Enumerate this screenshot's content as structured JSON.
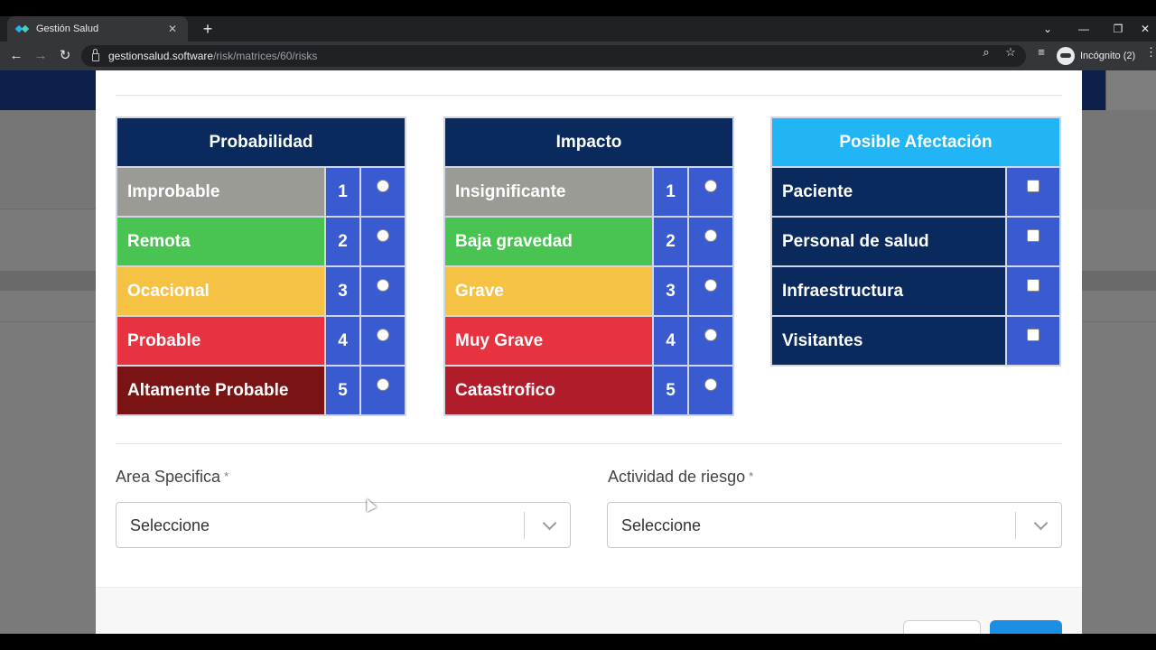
{
  "browser": {
    "tab_title": "Gestión Salud",
    "tab_close": "✕",
    "new_tab": "+",
    "url_host": "gestionsalud.software",
    "url_path": "/risk/matrices/60/risks",
    "profile_label": "Incógnito (2)",
    "icons": {
      "back": "←",
      "forward": "→",
      "reload": "↻",
      "zoom": "⌕",
      "star": "☆",
      "media": "≡",
      "menu": "⋮",
      "chevron": "⌄",
      "minimize": "—",
      "restore": "❐",
      "close": "✕"
    }
  },
  "probabilidad": {
    "header": "Probabilidad",
    "header_color": "#0a2a5e",
    "rows": [
      {
        "label": "Improbable",
        "value": "1",
        "color": "#9b9b95"
      },
      {
        "label": "Remota",
        "value": "2",
        "color": "#49c452"
      },
      {
        "label": "Ocacional",
        "value": "3",
        "color": "#f6c243"
      },
      {
        "label": "Probable",
        "value": "4",
        "color": "#e8323f"
      },
      {
        "label": "Altamente Probable",
        "value": "5",
        "color": "#7a1414"
      }
    ]
  },
  "impacto": {
    "header": "Impacto",
    "header_color": "#0a2a5e",
    "rows": [
      {
        "label": "Insignificante",
        "value": "1",
        "color": "#9b9b95"
      },
      {
        "label": "Baja gravedad",
        "value": "2",
        "color": "#49c452"
      },
      {
        "label": "Grave",
        "value": "3",
        "color": "#f6c243"
      },
      {
        "label": "Muy Grave",
        "value": "4",
        "color": "#e8323f"
      },
      {
        "label": "Catastrofico",
        "value": "5",
        "color": "#b01c2a"
      }
    ]
  },
  "afectacion": {
    "header": "Posible Afectación",
    "header_color": "#22b5f5",
    "row_color": "#0a2a5e",
    "rows": [
      {
        "label": "Paciente"
      },
      {
        "label": "Personal de salud"
      },
      {
        "label": "Infraestructura"
      },
      {
        "label": "Visitantes"
      }
    ]
  },
  "form": {
    "area": {
      "label": "Area Specifica",
      "required_mark": "*",
      "value": "Seleccione"
    },
    "actividad": {
      "label": "Actividad de riesgo",
      "required_mark": "*",
      "value": "Seleccione"
    }
  }
}
